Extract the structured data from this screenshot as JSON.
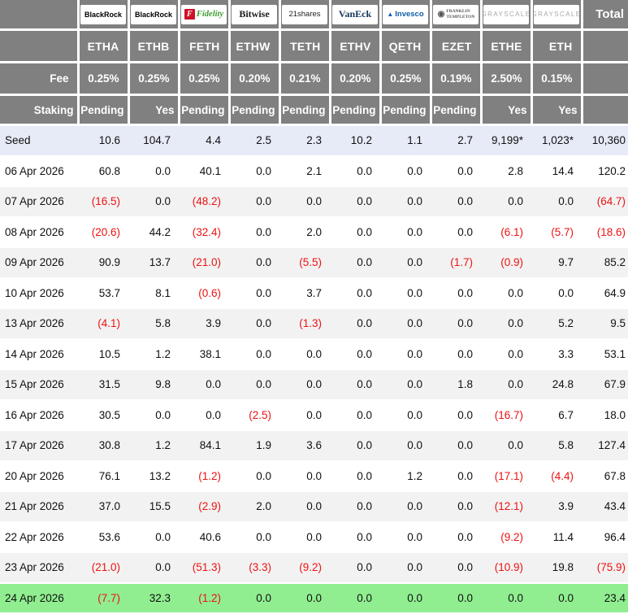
{
  "colors": {
    "header_gray": "#808080",
    "header_text": "#ffffff",
    "seed_row_bg": "#e7eaf7",
    "alt_row_bg": "#f2f2f2",
    "highlight_green": "#90ee90",
    "negative_red": "#ee1111"
  },
  "chart_data": {
    "type": "table",
    "fee_label": "Fee",
    "staking_label": "Staking",
    "total_label": "Total",
    "columns": [
      {
        "ticker": "ETHA",
        "fee": "0.25%",
        "staking": "Pending",
        "brand": "BlackRock",
        "logo_key": "blackrock"
      },
      {
        "ticker": "ETHB",
        "fee": "0.25%",
        "staking": "Yes",
        "brand": "BlackRock",
        "logo_key": "blackrock"
      },
      {
        "ticker": "FETH",
        "fee": "0.25%",
        "staking": "Pending",
        "brand": "Fidelity",
        "logo_key": "fidelity",
        "badge": "F"
      },
      {
        "ticker": "ETHW",
        "fee": "0.20%",
        "staking": "Pending",
        "brand": "Bitwise",
        "logo_key": "bitwise"
      },
      {
        "ticker": "TETH",
        "fee": "0.21%",
        "staking": "Pending",
        "brand": "21shares",
        "logo_key": "shares21"
      },
      {
        "ticker": "ETHV",
        "fee": "0.20%",
        "staking": "Pending",
        "brand": "VanEck",
        "logo_key": "vaneck"
      },
      {
        "ticker": "QETH",
        "fee": "0.25%",
        "staking": "Pending",
        "brand": "Invesco",
        "logo_key": "invesco",
        "badge": "▲"
      },
      {
        "ticker": "EZET",
        "fee": "0.19%",
        "staking": "Pending",
        "brand": "FRANKLIN TEMPLETON",
        "logo_key": "franklin",
        "badge": "◉"
      },
      {
        "ticker": "ETHE",
        "fee": "2.50%",
        "staking": "Yes",
        "brand": "GRAYSCALE",
        "logo_key": "grayscale"
      },
      {
        "ticker": "ETH",
        "fee": "0.15%",
        "staking": "Yes",
        "brand": "GRAYSCALE",
        "logo_key": "grayscale"
      }
    ],
    "rows": [
      {
        "label": "Seed",
        "values": [
          "10.6",
          "104.7",
          "4.4",
          "2.5",
          "2.3",
          "10.2",
          "1.1",
          "2.7",
          "9,199*",
          "1,023*"
        ],
        "total": "10,360",
        "highlight": "seed"
      },
      {
        "label": "06 Apr 2026",
        "values": [
          "60.8",
          "0.0",
          "40.1",
          "0.0",
          "2.1",
          "0.0",
          "0.0",
          "0.0",
          "2.8",
          "14.4"
        ],
        "total": "120.2"
      },
      {
        "label": "07 Apr 2026",
        "values": [
          "(16.5)",
          "0.0",
          "(48.2)",
          "0.0",
          "0.0",
          "0.0",
          "0.0",
          "0.0",
          "0.0",
          "0.0"
        ],
        "total": "(64.7)"
      },
      {
        "label": "08 Apr 2026",
        "values": [
          "(20.6)",
          "44.2",
          "(32.4)",
          "0.0",
          "2.0",
          "0.0",
          "0.0",
          "0.0",
          "(6.1)",
          "(5.7)"
        ],
        "total": "(18.6)"
      },
      {
        "label": "09 Apr 2026",
        "values": [
          "90.9",
          "13.7",
          "(21.0)",
          "0.0",
          "(5.5)",
          "0.0",
          "0.0",
          "(1.7)",
          "(0.9)",
          "9.7"
        ],
        "total": "85.2"
      },
      {
        "label": "10 Apr 2026",
        "values": [
          "53.7",
          "8.1",
          "(0.6)",
          "0.0",
          "3.7",
          "0.0",
          "0.0",
          "0.0",
          "0.0",
          "0.0"
        ],
        "total": "64.9"
      },
      {
        "label": "13 Apr 2026",
        "values": [
          "(4.1)",
          "5.8",
          "3.9",
          "0.0",
          "(1.3)",
          "0.0",
          "0.0",
          "0.0",
          "0.0",
          "5.2"
        ],
        "total": "9.5"
      },
      {
        "label": "14 Apr 2026",
        "values": [
          "10.5",
          "1.2",
          "38.1",
          "0.0",
          "0.0",
          "0.0",
          "0.0",
          "0.0",
          "0.0",
          "3.3"
        ],
        "total": "53.1"
      },
      {
        "label": "15 Apr 2026",
        "values": [
          "31.5",
          "9.8",
          "0.0",
          "0.0",
          "0.0",
          "0.0",
          "0.0",
          "1.8",
          "0.0",
          "24.8"
        ],
        "total": "67.9"
      },
      {
        "label": "16 Apr 2026",
        "values": [
          "30.5",
          "0.0",
          "0.0",
          "(2.5)",
          "0.0",
          "0.0",
          "0.0",
          "0.0",
          "(16.7)",
          "6.7"
        ],
        "total": "18.0"
      },
      {
        "label": "17 Apr 2026",
        "values": [
          "30.8",
          "1.2",
          "84.1",
          "1.9",
          "3.6",
          "0.0",
          "0.0",
          "0.0",
          "0.0",
          "5.8"
        ],
        "total": "127.4"
      },
      {
        "label": "20 Apr 2026",
        "values": [
          "76.1",
          "13.2",
          "(1.2)",
          "0.0",
          "0.0",
          "0.0",
          "1.2",
          "0.0",
          "(17.1)",
          "(4.4)"
        ],
        "total": "67.8"
      },
      {
        "label": "21 Apr 2026",
        "values": [
          "37.0",
          "15.5",
          "(2.9)",
          "2.0",
          "0.0",
          "0.0",
          "0.0",
          "0.0",
          "(12.1)",
          "3.9"
        ],
        "total": "43.4"
      },
      {
        "label": "22 Apr 2026",
        "values": [
          "53.6",
          "0.0",
          "40.6",
          "0.0",
          "0.0",
          "0.0",
          "0.0",
          "0.0",
          "(9.2)",
          "11.4"
        ],
        "total": "96.4"
      },
      {
        "label": "23 Apr 2026",
        "values": [
          "(21.0)",
          "0.0",
          "(51.3)",
          "(3.3)",
          "(9.2)",
          "0.0",
          "0.0",
          "0.0",
          "(10.9)",
          "19.8"
        ],
        "total": "(75.9)"
      },
      {
        "label": "24 Apr 2026",
        "values": [
          "(7.7)",
          "32.3",
          "(1.2)",
          "0.0",
          "0.0",
          "0.0",
          "0.0",
          "0.0",
          "0.0",
          "0.0"
        ],
        "total": "23.4",
        "highlight": "green"
      }
    ]
  }
}
